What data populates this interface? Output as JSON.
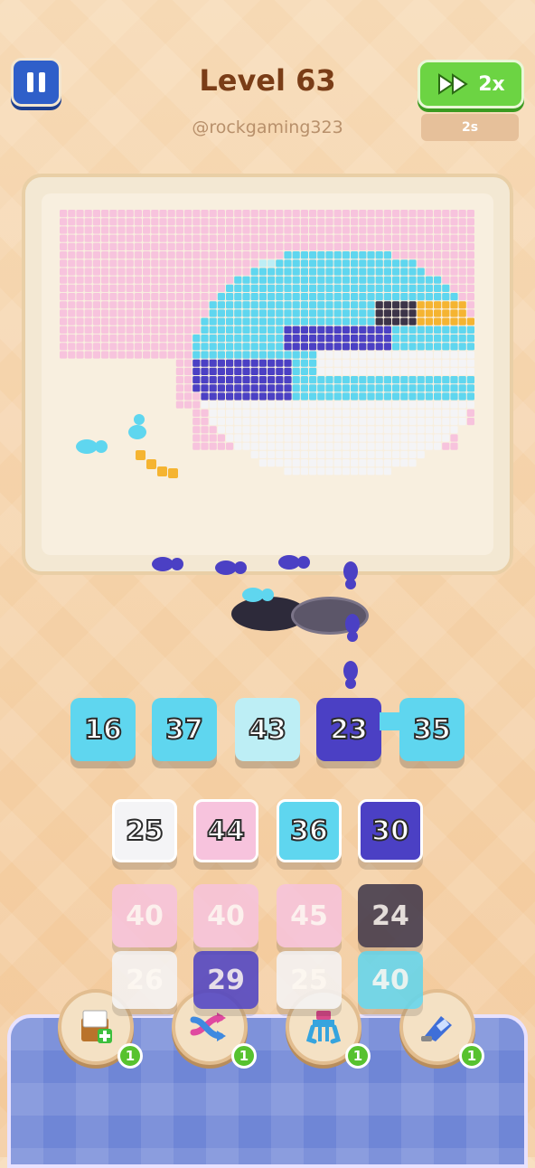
{
  "header": {
    "level_title": "Level 63",
    "username": "@rockgaming323",
    "speed_label": "2x",
    "timer": "2s"
  },
  "colors": {
    "light_blue": "#5fd6ef",
    "pale_blue": "#bdeef5",
    "purple": "#4b40c4",
    "pink": "#f7c3dd",
    "white": "#f4f4f6",
    "dark": "#3c3448",
    "orange": "#f5b431"
  },
  "slots": [
    {
      "value": "16",
      "color": "#5fd6ef"
    },
    {
      "value": "37",
      "color": "#5fd6ef"
    },
    {
      "value": "43",
      "color": "#bdeef5"
    },
    {
      "value": "23",
      "color": "#4b40c4"
    },
    {
      "value": "35",
      "color": "#5fd6ef"
    }
  ],
  "tile_rows": [
    [
      {
        "value": "25",
        "color": "#f4f4f6",
        "state": "active"
      },
      {
        "value": "44",
        "color": "#f7c3dd",
        "state": "active"
      },
      {
        "value": "36",
        "color": "#5fd6ef",
        "state": "active"
      },
      {
        "value": "30",
        "color": "#4b40c4",
        "state": "active"
      }
    ],
    [
      {
        "value": "40",
        "color": "#f7c3dd",
        "state": "faded"
      },
      {
        "value": "40",
        "color": "#f7c3dd",
        "state": "faded"
      },
      {
        "value": "45",
        "color": "#f7c3dd",
        "state": "faded"
      },
      {
        "value": "24",
        "color": "#3c3448",
        "state": "faded"
      }
    ],
    [
      {
        "value": "26",
        "color": "#f4f4f6",
        "state": "faded"
      },
      {
        "value": "29",
        "color": "#4b40c4",
        "state": "faded"
      },
      {
        "value": "25",
        "color": "#f4f4f6",
        "state": "faded"
      },
      {
        "value": "40",
        "color": "#5fd6ef",
        "state": "faded"
      }
    ]
  ],
  "boosters": [
    {
      "name": "add-slot",
      "icon": "add-box-icon",
      "count": "1"
    },
    {
      "name": "shuffle",
      "icon": "shuffle-icon",
      "count": "1"
    },
    {
      "name": "magnet",
      "icon": "magnet-icon",
      "count": "1"
    },
    {
      "name": "vacuum",
      "icon": "vacuum-icon",
      "count": "1"
    }
  ]
}
